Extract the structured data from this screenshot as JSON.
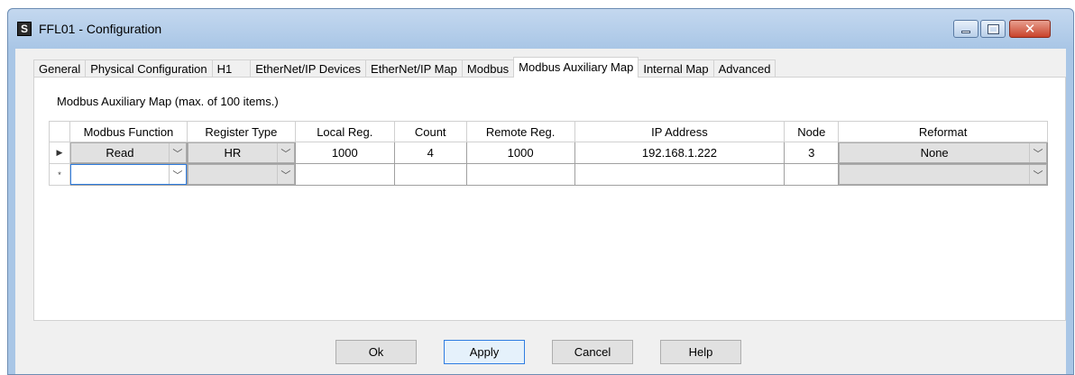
{
  "window": {
    "title": "FFL01 - Configuration",
    "app_icon_glyph": "S",
    "controls": {
      "minimize": "minimize-icon",
      "maximize": "maximize-icon",
      "close_glyph": "✕"
    }
  },
  "tabs": [
    {
      "label": "General"
    },
    {
      "label": "Physical Configuration"
    },
    {
      "label": "H1"
    },
    {
      "label": "EtherNet/IP Devices"
    },
    {
      "label": "EtherNet/IP Map"
    },
    {
      "label": "Modbus"
    },
    {
      "label": "Modbus Auxiliary Map",
      "active": true
    },
    {
      "label": "Internal Map"
    },
    {
      "label": "Advanced"
    }
  ],
  "panel": {
    "label": "Modbus Auxiliary Map (max. of 100 items.)"
  },
  "grid": {
    "columns": [
      "Modbus Function",
      "Register Type",
      "Local Reg.",
      "Count",
      "Remote Reg.",
      "IP Address",
      "Node",
      "Reformat"
    ],
    "rows": [
      {
        "indicator": "▶",
        "modbus_function": "Read",
        "register_type": "HR",
        "local_reg": "1000",
        "count": "4",
        "remote_reg": "1000",
        "ip_address": "192.168.1.222",
        "node": "3",
        "reformat": "None"
      },
      {
        "indicator": "*",
        "modbus_function": "",
        "register_type": "",
        "local_reg": "",
        "count": "",
        "remote_reg": "",
        "ip_address": "",
        "node": "",
        "reformat": ""
      }
    ],
    "dropdown_glyph": "﹀"
  },
  "buttons": {
    "ok": "Ok",
    "apply": "Apply",
    "cancel": "Cancel",
    "help": "Help"
  },
  "colors": {
    "accent_border": "#2f7de1",
    "titlebar": "#a9c6e6",
    "close_button": "#c9422a"
  }
}
